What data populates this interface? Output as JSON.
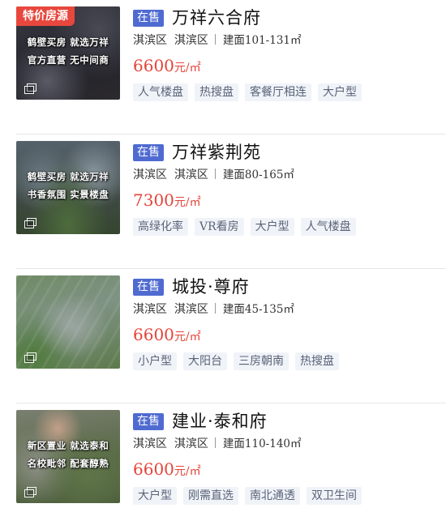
{
  "listings": [
    {
      "promo": "特价房源",
      "thumb_slogan_1": "鹤壁买房 就选万祥",
      "thumb_slogan_2": "官方直营 无中间商",
      "status": "在售",
      "name": "万祥六合府",
      "district": "淇滨区",
      "subdistrict": "淇滨区",
      "area": "建面101-131㎡",
      "price": "6600",
      "price_unit": "元/㎡",
      "tags": [
        "人气楼盘",
        "热搜盘",
        "客餐厅相连",
        "大户型"
      ]
    },
    {
      "thumb_slogan_1": "鹤壁买房 就选万祥",
      "thumb_slogan_2": "书香氛围 实景楼盘",
      "status": "在售",
      "name": "万祥紫荆苑",
      "district": "淇滨区",
      "subdistrict": "淇滨区",
      "area": "建面80-165㎡",
      "price": "7300",
      "price_unit": "元/㎡",
      "tags": [
        "高绿化率",
        "VR看房",
        "大户型",
        "人气楼盘"
      ]
    },
    {
      "status": "在售",
      "name": "城投·尊府",
      "district": "淇滨区",
      "subdistrict": "淇滨区",
      "area": "建面45-135㎡",
      "price": "6600",
      "price_unit": "元/㎡",
      "tags": [
        "小户型",
        "大阳台",
        "三房朝南",
        "热搜盘"
      ]
    },
    {
      "thumb_slogan_1": "新区置业 就选泰和",
      "thumb_slogan_2": "名校毗邻 配套醇熟",
      "status": "在售",
      "name": "建业·泰和府",
      "district": "淇滨区",
      "subdistrict": "淇滨区",
      "area": "建面110-140㎡",
      "price": "6600",
      "price_unit": "元/㎡",
      "tags": [
        "大户型",
        "刚需直选",
        "南北通透",
        "双卫生间"
      ]
    }
  ],
  "colors": {
    "price": "#e4453a",
    "status_badge": "#4f6bd1",
    "promo_badge": "#e8473d",
    "tag_bg": "#f0f3f8",
    "tag_text": "#5a6378"
  },
  "icons": {
    "album": "photo-album-icon"
  }
}
